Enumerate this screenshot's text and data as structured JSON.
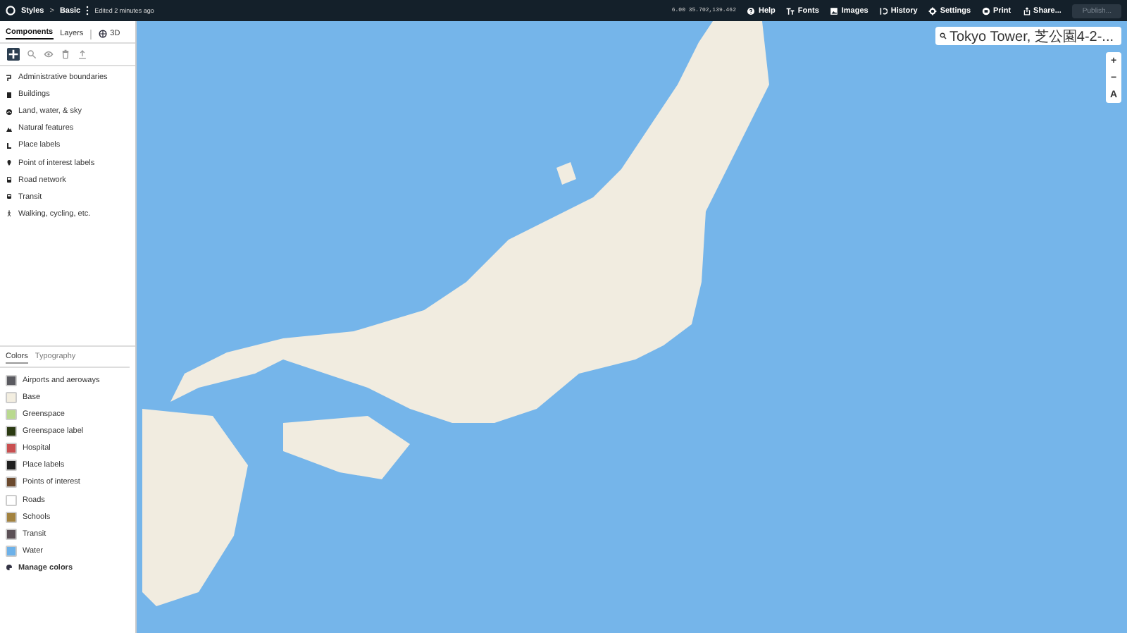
{
  "topbar": {
    "app": "Styles",
    "separator": ">",
    "style_name": "Basic",
    "edited": "Edited 2 minutes ago",
    "coordinates": "6.00 35.702,139.462",
    "actions": [
      {
        "label": "Help"
      },
      {
        "label": "Fonts"
      },
      {
        "label": "Images"
      },
      {
        "label": "History"
      },
      {
        "label": "Settings"
      },
      {
        "label": "Print"
      },
      {
        "label": "Share..."
      }
    ],
    "publish": {
      "label": "Publish...",
      "disabled": true
    }
  },
  "sidebar": {
    "tabs": [
      {
        "label": "Components",
        "selected": true
      },
      {
        "label": "Layers",
        "selected": false
      },
      {
        "label": "3D",
        "selected": false
      }
    ],
    "tools": [
      {
        "selected": true
      },
      {
        "selected": false
      },
      {
        "selected": false
      },
      {
        "selected": false
      },
      {
        "selected": false
      }
    ],
    "components": [
      "Administrative boundaries",
      "Buildings",
      "Land, water, & sky",
      "Natural features",
      "Place labels",
      "Point of interest labels",
      "Road network",
      "Transit",
      "Walking, cycling, etc."
    ],
    "bottom_tabs": [
      {
        "label": "Colors",
        "selected": true
      },
      {
        "label": "Typography",
        "selected": false
      }
    ],
    "colors": [
      {
        "name": "Airports and aeroways",
        "color": "#5a5a60"
      },
      {
        "name": "Base",
        "color": "#f3eee0"
      },
      {
        "name": "Greenspace",
        "color": "#b9d98f"
      },
      {
        "name": "Greenspace label",
        "color": "#2b3a12"
      },
      {
        "name": "Hospital",
        "color": "#c94f50"
      },
      {
        "name": "Place labels",
        "color": "#1f1f1f"
      },
      {
        "name": "Points of interest",
        "color": "#6b4a2e"
      },
      {
        "name": "Roads",
        "color": "#ffffff"
      },
      {
        "name": "Schools",
        "color": "#a2823f"
      },
      {
        "name": "Transit",
        "color": "#5b5056"
      },
      {
        "name": "Water",
        "color": "#6cb1e9"
      }
    ],
    "manage_colors": "Manage colors"
  },
  "map": {
    "search": {
      "value": "Tokyo Tower, 芝公園4-2-..."
    },
    "controls": [
      {
        "label": "+"
      },
      {
        "label": "−"
      },
      {
        "label": "A"
      }
    ]
  }
}
